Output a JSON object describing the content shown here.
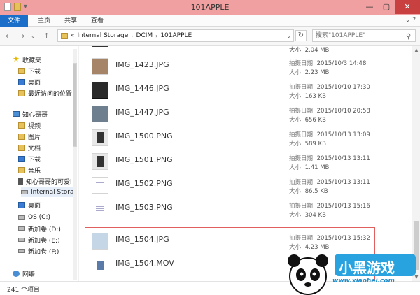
{
  "window": {
    "title": "101APPLE",
    "minimize": "—",
    "maximize": "▢",
    "close": "✕"
  },
  "ribbon": {
    "tabs": [
      "文件",
      "主页",
      "共享",
      "查看"
    ],
    "help": "⌄ ?"
  },
  "nav": {
    "breadcrumb": [
      "«",
      "Internal Storage",
      "DCIM",
      "101APPLE"
    ],
    "search_placeholder": "搜索\"101APPLE\""
  },
  "sidebar": {
    "items": [
      {
        "label": "收藏夹",
        "icon": "star-icon"
      },
      {
        "label": "下载",
        "icon": "folder-icon"
      },
      {
        "label": "桌面",
        "icon": "folder-icon"
      },
      {
        "label": "最近访问的位置",
        "icon": "folder-icon"
      },
      {
        "label": "知心哥哥",
        "icon": "pc-icon"
      },
      {
        "label": "视频",
        "icon": "folder-icon"
      },
      {
        "label": "图片",
        "icon": "folder-icon"
      },
      {
        "label": "文档",
        "icon": "folder-icon"
      },
      {
        "label": "下载",
        "icon": "folder-icon"
      },
      {
        "label": "音乐",
        "icon": "folder-icon"
      },
      {
        "label": "知心哥哥的可爱i",
        "icon": "phone-icon"
      },
      {
        "label": "Internal Stora",
        "icon": "drive-icon"
      },
      {
        "label": "桌面",
        "icon": "folder-icon"
      },
      {
        "label": "OS (C:)",
        "icon": "drive-icon"
      },
      {
        "label": "新加卷 (D:)",
        "icon": "drive-icon"
      },
      {
        "label": "新加卷 (E:)",
        "icon": "drive-icon"
      },
      {
        "label": "新加卷 (F:)",
        "icon": "drive-icon"
      },
      {
        "label": "网络",
        "icon": "network-icon"
      }
    ]
  },
  "files": {
    "partial_size": "大小: 2.04 MB",
    "date_key": "拍摄日期:",
    "size_key": "大小:",
    "rows": [
      {
        "name": "IMG_1423.JPG",
        "date": "2015/10/3 14:48",
        "size": "2.23 MB"
      },
      {
        "name": "IMG_1446.JPG",
        "date": "2015/10/10 17:30",
        "size": "163 KB"
      },
      {
        "name": "IMG_1447.JPG",
        "date": "2015/10/10 20:58",
        "size": "656 KB"
      },
      {
        "name": "IMG_1500.PNG",
        "date": "2015/10/13 13:09",
        "size": "589 KB"
      },
      {
        "name": "IMG_1501.PNG",
        "date": "2015/10/13 13:11",
        "size": "1.41 MB"
      },
      {
        "name": "IMG_1502.PNG",
        "date": "2015/10/13 13:11",
        "size": "86.5 KB"
      },
      {
        "name": "IMG_1503.PNG",
        "date": "2015/10/13 15:16",
        "size": "304 KB"
      },
      {
        "name": "IMG_1504.JPG",
        "date": "2015/10/13 15:32",
        "size": "4.23 MB"
      },
      {
        "name": "IMG_1504.MOV"
      }
    ]
  },
  "status": {
    "count": "241 个项目"
  },
  "watermark": {
    "site": "www.xiaohei.com",
    "logo_text": "小黑游戏"
  }
}
